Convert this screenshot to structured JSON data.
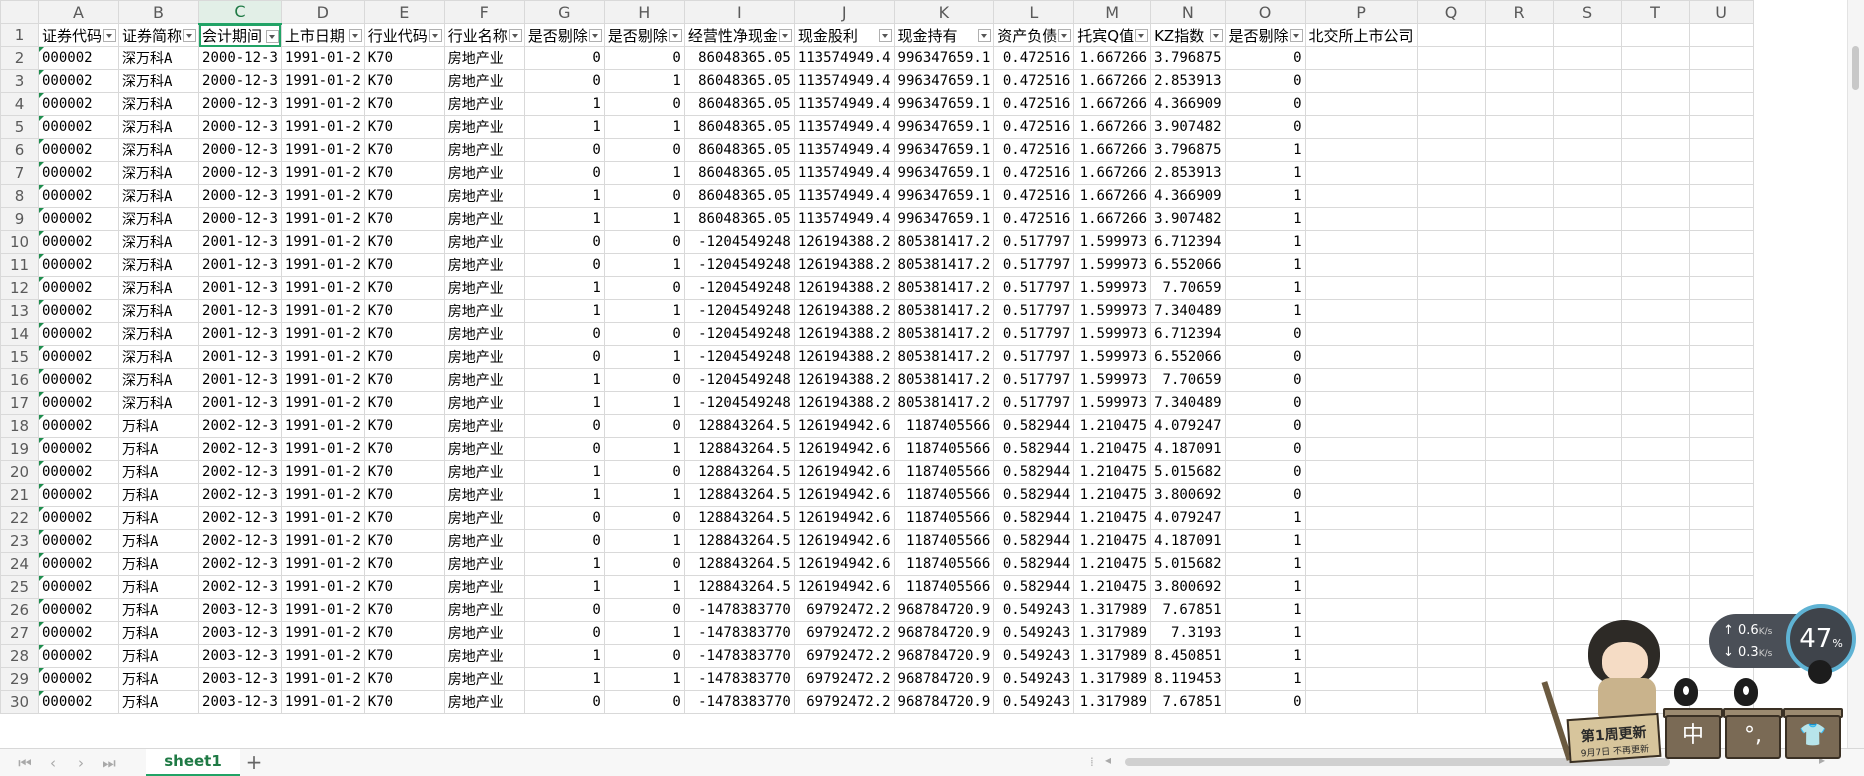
{
  "columns": [
    "A",
    "B",
    "C",
    "D",
    "E",
    "F",
    "G",
    "H",
    "I",
    "J",
    "K",
    "L",
    "M",
    "N",
    "O",
    "P",
    "Q",
    "R",
    "S",
    "T",
    "U"
  ],
  "selected_column": "C",
  "selected_cell": "C1",
  "header_row": [
    "证券代码",
    "证券简称",
    "会计期间",
    "上市日期",
    "行业代码",
    "行业名称",
    "是否剔除",
    "是否剔除",
    "经营性净现金",
    "现金股利",
    "现金持有",
    "资产负债",
    "托宾Q值",
    "KZ指数",
    "是否剔除",
    "北交所上市公司"
  ],
  "rows": [
    [
      "000002",
      "深万科A",
      "2000-12-3",
      "1991-01-2",
      "K70",
      "房地产业",
      "0",
      "0",
      "86048365.05",
      "113574949.4",
      "996347659.1",
      "0.472516",
      "1.667266",
      "3.796875",
      "0"
    ],
    [
      "000002",
      "深万科A",
      "2000-12-3",
      "1991-01-2",
      "K70",
      "房地产业",
      "0",
      "1",
      "86048365.05",
      "113574949.4",
      "996347659.1",
      "0.472516",
      "1.667266",
      "2.853913",
      "0"
    ],
    [
      "000002",
      "深万科A",
      "2000-12-3",
      "1991-01-2",
      "K70",
      "房地产业",
      "1",
      "0",
      "86048365.05",
      "113574949.4",
      "996347659.1",
      "0.472516",
      "1.667266",
      "4.366909",
      "0"
    ],
    [
      "000002",
      "深万科A",
      "2000-12-3",
      "1991-01-2",
      "K70",
      "房地产业",
      "1",
      "1",
      "86048365.05",
      "113574949.4",
      "996347659.1",
      "0.472516",
      "1.667266",
      "3.907482",
      "0"
    ],
    [
      "000002",
      "深万科A",
      "2000-12-3",
      "1991-01-2",
      "K70",
      "房地产业",
      "0",
      "0",
      "86048365.05",
      "113574949.4",
      "996347659.1",
      "0.472516",
      "1.667266",
      "3.796875",
      "1"
    ],
    [
      "000002",
      "深万科A",
      "2000-12-3",
      "1991-01-2",
      "K70",
      "房地产业",
      "0",
      "1",
      "86048365.05",
      "113574949.4",
      "996347659.1",
      "0.472516",
      "1.667266",
      "2.853913",
      "1"
    ],
    [
      "000002",
      "深万科A",
      "2000-12-3",
      "1991-01-2",
      "K70",
      "房地产业",
      "1",
      "0",
      "86048365.05",
      "113574949.4",
      "996347659.1",
      "0.472516",
      "1.667266",
      "4.366909",
      "1"
    ],
    [
      "000002",
      "深万科A",
      "2000-12-3",
      "1991-01-2",
      "K70",
      "房地产业",
      "1",
      "1",
      "86048365.05",
      "113574949.4",
      "996347659.1",
      "0.472516",
      "1.667266",
      "3.907482",
      "1"
    ],
    [
      "000002",
      "深万科A",
      "2001-12-3",
      "1991-01-2",
      "K70",
      "房地产业",
      "0",
      "0",
      "-1204549248",
      "126194388.2",
      "805381417.2",
      "0.517797",
      "1.599973",
      "6.712394",
      "1"
    ],
    [
      "000002",
      "深万科A",
      "2001-12-3",
      "1991-01-2",
      "K70",
      "房地产业",
      "0",
      "1",
      "-1204549248",
      "126194388.2",
      "805381417.2",
      "0.517797",
      "1.599973",
      "6.552066",
      "1"
    ],
    [
      "000002",
      "深万科A",
      "2001-12-3",
      "1991-01-2",
      "K70",
      "房地产业",
      "1",
      "0",
      "-1204549248",
      "126194388.2",
      "805381417.2",
      "0.517797",
      "1.599973",
      "7.70659",
      "1"
    ],
    [
      "000002",
      "深万科A",
      "2001-12-3",
      "1991-01-2",
      "K70",
      "房地产业",
      "1",
      "1",
      "-1204549248",
      "126194388.2",
      "805381417.2",
      "0.517797",
      "1.599973",
      "7.340489",
      "1"
    ],
    [
      "000002",
      "深万科A",
      "2001-12-3",
      "1991-01-2",
      "K70",
      "房地产业",
      "0",
      "0",
      "-1204549248",
      "126194388.2",
      "805381417.2",
      "0.517797",
      "1.599973",
      "6.712394",
      "0"
    ],
    [
      "000002",
      "深万科A",
      "2001-12-3",
      "1991-01-2",
      "K70",
      "房地产业",
      "0",
      "1",
      "-1204549248",
      "126194388.2",
      "805381417.2",
      "0.517797",
      "1.599973",
      "6.552066",
      "0"
    ],
    [
      "000002",
      "深万科A",
      "2001-12-3",
      "1991-01-2",
      "K70",
      "房地产业",
      "1",
      "0",
      "-1204549248",
      "126194388.2",
      "805381417.2",
      "0.517797",
      "1.599973",
      "7.70659",
      "0"
    ],
    [
      "000002",
      "深万科A",
      "2001-12-3",
      "1991-01-2",
      "K70",
      "房地产业",
      "1",
      "1",
      "-1204549248",
      "126194388.2",
      "805381417.2",
      "0.517797",
      "1.599973",
      "7.340489",
      "0"
    ],
    [
      "000002",
      "万科A",
      "2002-12-3",
      "1991-01-2",
      "K70",
      "房地产业",
      "0",
      "0",
      "128843264.5",
      "126194942.6",
      "1187405566",
      "0.582944",
      "1.210475",
      "4.079247",
      "0"
    ],
    [
      "000002",
      "万科A",
      "2002-12-3",
      "1991-01-2",
      "K70",
      "房地产业",
      "0",
      "1",
      "128843264.5",
      "126194942.6",
      "1187405566",
      "0.582944",
      "1.210475",
      "4.187091",
      "0"
    ],
    [
      "000002",
      "万科A",
      "2002-12-3",
      "1991-01-2",
      "K70",
      "房地产业",
      "1",
      "0",
      "128843264.5",
      "126194942.6",
      "1187405566",
      "0.582944",
      "1.210475",
      "5.015682",
      "0"
    ],
    [
      "000002",
      "万科A",
      "2002-12-3",
      "1991-01-2",
      "K70",
      "房地产业",
      "1",
      "1",
      "128843264.5",
      "126194942.6",
      "1187405566",
      "0.582944",
      "1.210475",
      "3.800692",
      "0"
    ],
    [
      "000002",
      "万科A",
      "2002-12-3",
      "1991-01-2",
      "K70",
      "房地产业",
      "0",
      "0",
      "128843264.5",
      "126194942.6",
      "1187405566",
      "0.582944",
      "1.210475",
      "4.079247",
      "1"
    ],
    [
      "000002",
      "万科A",
      "2002-12-3",
      "1991-01-2",
      "K70",
      "房地产业",
      "0",
      "1",
      "128843264.5",
      "126194942.6",
      "1187405566",
      "0.582944",
      "1.210475",
      "4.187091",
      "1"
    ],
    [
      "000002",
      "万科A",
      "2002-12-3",
      "1991-01-2",
      "K70",
      "房地产业",
      "1",
      "0",
      "128843264.5",
      "126194942.6",
      "1187405566",
      "0.582944",
      "1.210475",
      "5.015682",
      "1"
    ],
    [
      "000002",
      "万科A",
      "2002-12-3",
      "1991-01-2",
      "K70",
      "房地产业",
      "1",
      "1",
      "128843264.5",
      "126194942.6",
      "1187405566",
      "0.582944",
      "1.210475",
      "3.800692",
      "1"
    ],
    [
      "000002",
      "万科A",
      "2003-12-3",
      "1991-01-2",
      "K70",
      "房地产业",
      "0",
      "0",
      "-1478383770",
      "69792472.2",
      "968784720.9",
      "0.549243",
      "1.317989",
      "7.67851",
      "1"
    ],
    [
      "000002",
      "万科A",
      "2003-12-3",
      "1991-01-2",
      "K70",
      "房地产业",
      "0",
      "1",
      "-1478383770",
      "69792472.2",
      "968784720.9",
      "0.549243",
      "1.317989",
      "7.3193",
      "1"
    ],
    [
      "000002",
      "万科A",
      "2003-12-3",
      "1991-01-2",
      "K70",
      "房地产业",
      "1",
      "0",
      "-1478383770",
      "69792472.2",
      "968784720.9",
      "0.549243",
      "1.317989",
      "8.450851",
      "1"
    ],
    [
      "000002",
      "万科A",
      "2003-12-3",
      "1991-01-2",
      "K70",
      "房地产业",
      "1",
      "1",
      "-1478383770",
      "69792472.2",
      "968784720.9",
      "0.549243",
      "1.317989",
      "8.119453",
      "1"
    ],
    [
      "000002",
      "万科A",
      "2003-12-3",
      "1991-01-2",
      "K70",
      "房地产业",
      "0",
      "0",
      "-1478383770",
      "69792472.2",
      "968784720.9",
      "0.549243",
      "1.317989",
      "7.67851",
      "0"
    ]
  ],
  "sheet_tab": "sheet1",
  "add_sheet_icon": "+",
  "nav_icons": [
    "⏮",
    "‹",
    "›",
    "⏭"
  ],
  "net": {
    "up": "0.6",
    "down": "0.3",
    "unit": "K/s"
  },
  "cpu": {
    "value": "47",
    "unit": "%"
  },
  "mascot": {
    "board_text": "第1周更新",
    "board_sub": "9月7日 不再更新",
    "box1": "中",
    "box2": "°,",
    "box3": "👕"
  },
  "colors": {
    "accent": "#21a366",
    "header_bg": "#f2f2f2",
    "grid": "#d9d9d9"
  }
}
